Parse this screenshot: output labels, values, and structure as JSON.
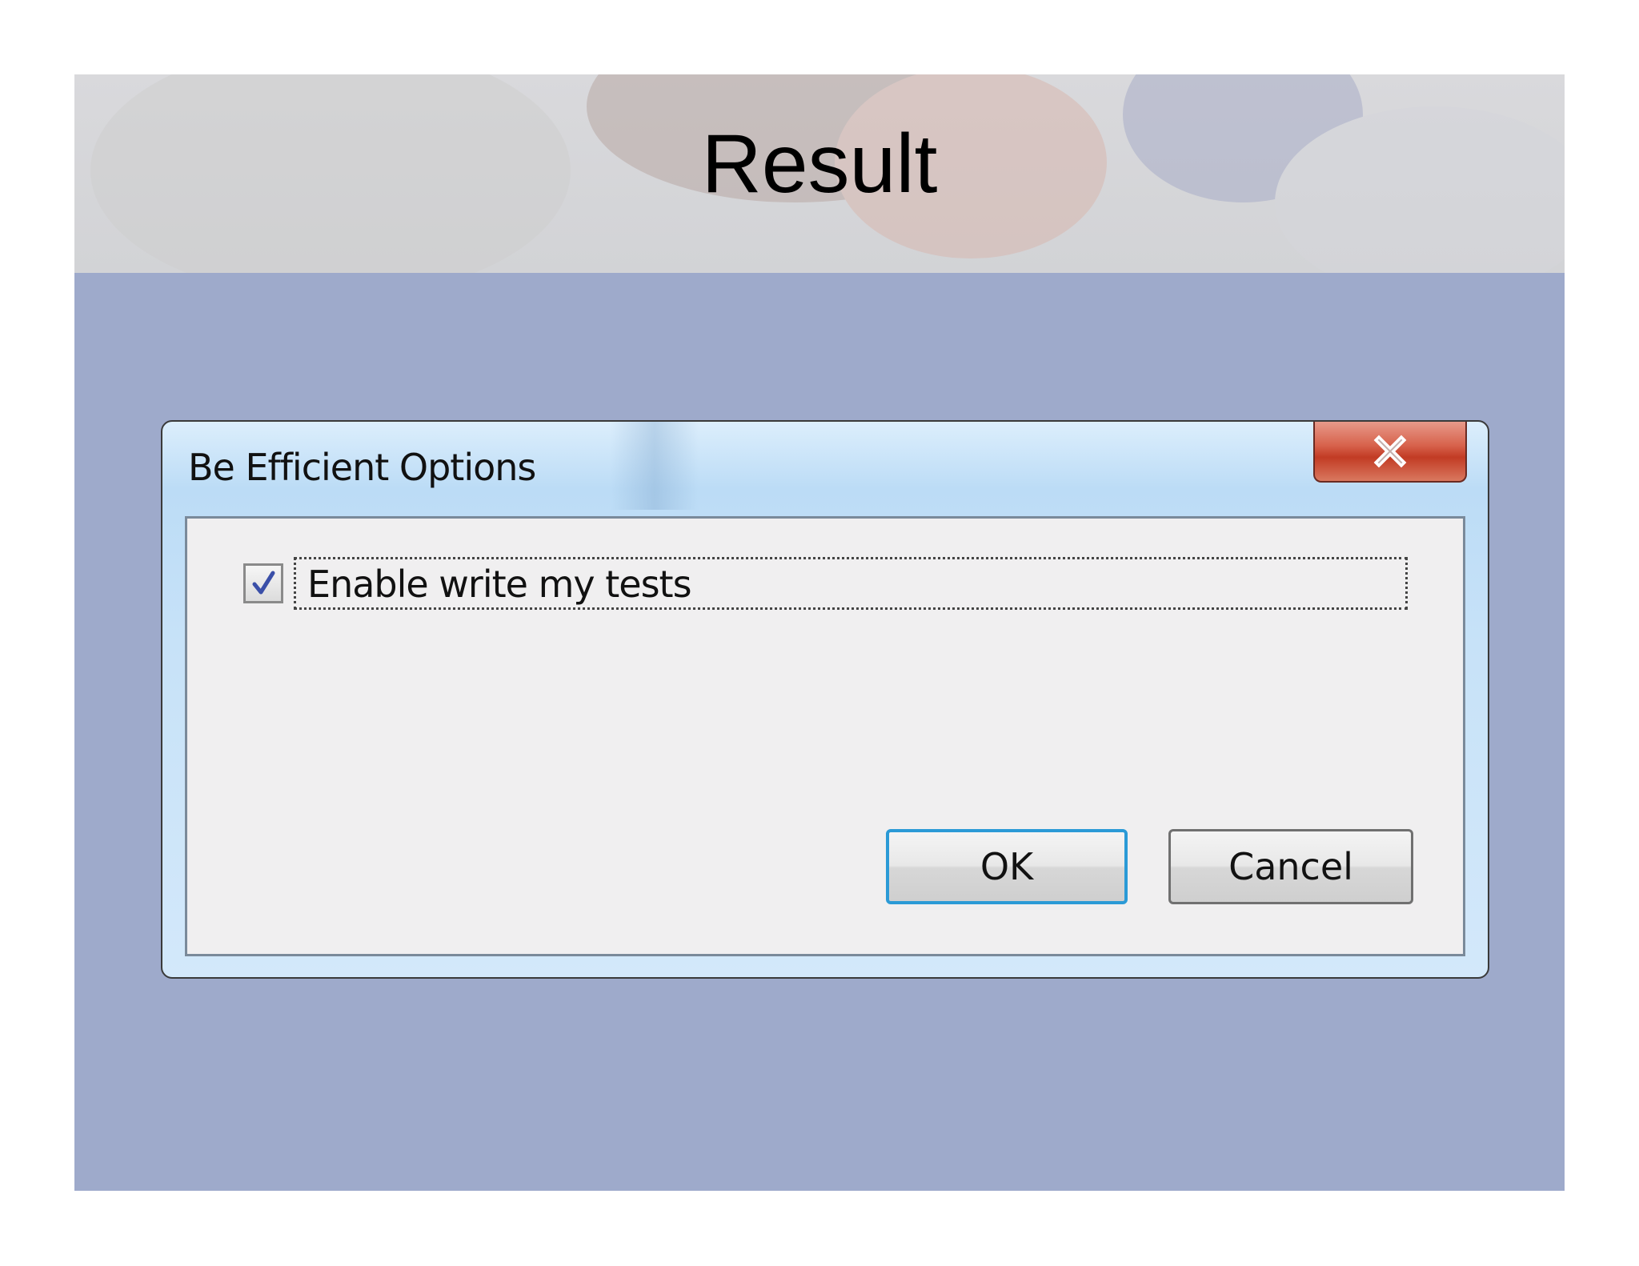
{
  "slide": {
    "title": "Result"
  },
  "dialog": {
    "title": "Be Efficient Options",
    "close_icon": "close-icon",
    "checkbox": {
      "label": "Enable write my tests",
      "checked": true
    },
    "buttons": {
      "ok_label": "OK",
      "cancel_label": "Cancel"
    }
  },
  "colors": {
    "slide_background": "#9eaacb",
    "close_button": "#c23b24",
    "ok_focus_border": "#2b9ad6",
    "client_area": "#f0eff0"
  }
}
